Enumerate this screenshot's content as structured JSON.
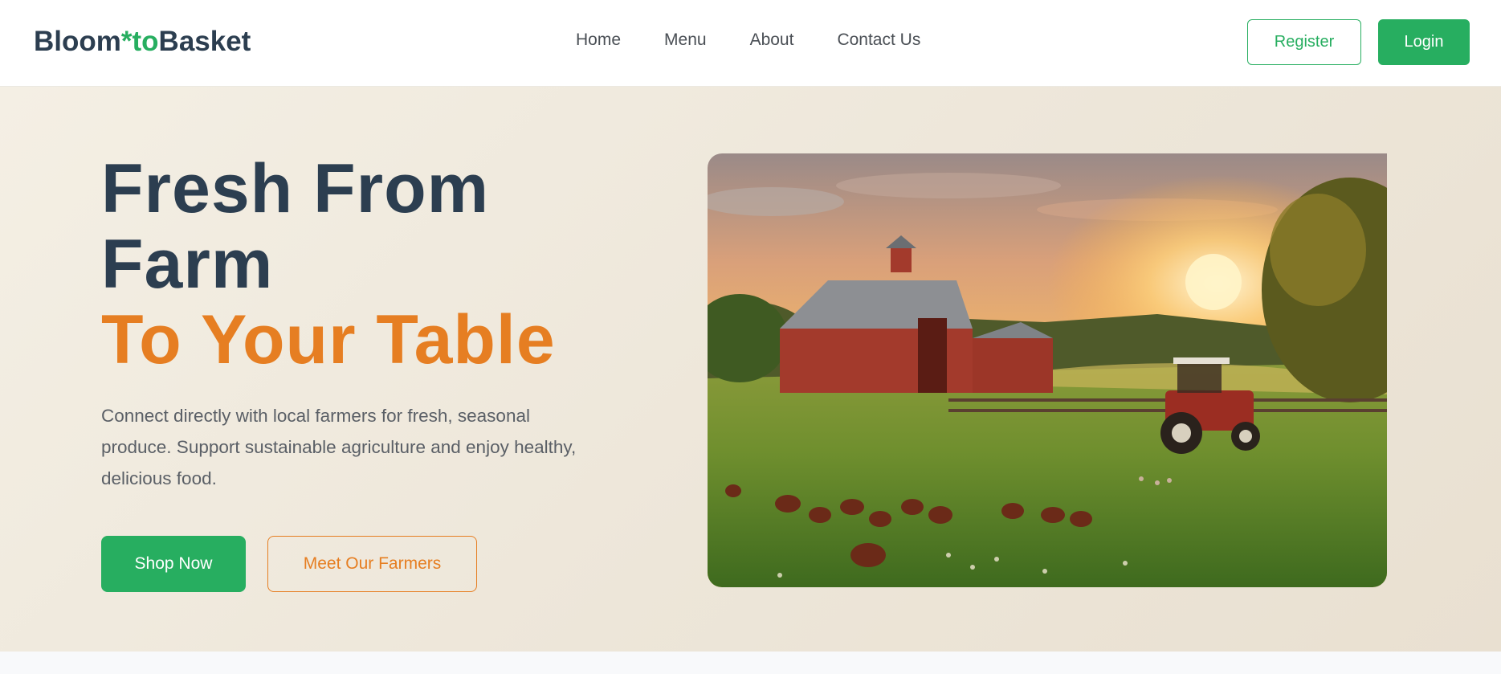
{
  "brand": {
    "part1": "Bloom",
    "part2": "*to",
    "part3": "Basket"
  },
  "nav": {
    "items": [
      "Home",
      "Menu",
      "About",
      "Contact Us"
    ]
  },
  "auth": {
    "register_label": "Register",
    "login_label": "Login"
  },
  "hero": {
    "title_line1": "Fresh From",
    "title_line2": "Farm",
    "title_highlight": "To Your Table",
    "description": "Connect directly with local farmers for fresh, seasonal produce. Support sustainable agriculture and enjoy healthy, delicious food.",
    "primary_button": "Shop Now",
    "secondary_button": "Meet Our Farmers",
    "image_subject": "farm-sunset-barn-tractor-chickens"
  },
  "colors": {
    "brand_green": "#27ae60",
    "brand_dark": "#2c3e50",
    "accent_orange": "#e67e22",
    "hero_bg": "#f1ebe0"
  }
}
